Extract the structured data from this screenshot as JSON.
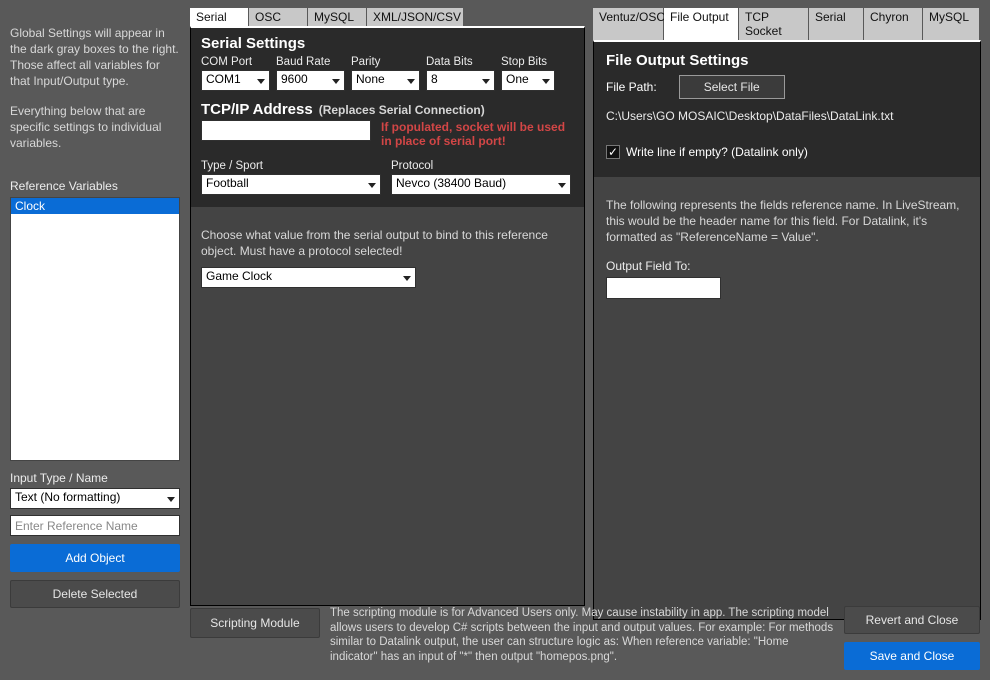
{
  "intro": {
    "p1": "Global Settings will appear in the dark gray boxes to the right. Those affect all variables for that Input/Output type.",
    "p2": "Everything below that are specific settings to individual variables."
  },
  "reference_variables": {
    "label": "Reference Variables",
    "items": [
      "Clock"
    ]
  },
  "input_type": {
    "label": "Input Type / Name",
    "value": "Text (No formatting)"
  },
  "ref_name_placeholder": "Enter Reference Name",
  "buttons": {
    "add_object": "Add Object",
    "delete_selected": "Delete Selected",
    "scripting_module": "Scripting Module",
    "revert_close": "Revert and Close",
    "save_close": "Save and Close"
  },
  "input_tabs": [
    "Serial",
    "OSC",
    "MySQL",
    "XML/JSON/CSV"
  ],
  "input_tab_widths": [
    58,
    58,
    58,
    96
  ],
  "input_active_tab": 0,
  "serial": {
    "title": "Serial Settings",
    "labels": {
      "com": "COM Port",
      "baud": "Baud Rate",
      "parity": "Parity",
      "data_bits": "Data Bits",
      "stop_bits": "Stop Bits"
    },
    "values": {
      "com": "COM1",
      "baud": "9600",
      "parity": "None",
      "data_bits": "8",
      "stop_bits": "One"
    },
    "tcp_title": "TCP/IP Address",
    "tcp_sub": "(Replaces Serial Connection)",
    "tcp_value": "",
    "tcp_warn1": "If populated, socket will be used",
    "tcp_warn2": "in place of serial port!",
    "type_label": "Type / Sport",
    "type_value": "Football",
    "protocol_label": "Protocol",
    "protocol_value": "Nevco (38400 Baud)"
  },
  "bind": {
    "help": "Choose what value from the serial output to bind to this reference object. Must have a protocol selected!",
    "value": "Game Clock"
  },
  "output_tabs": [
    "Ventuz/OSC",
    "File Output",
    "TCP Socket",
    "Serial",
    "Chyron",
    "MySQL"
  ],
  "output_tab_widths": [
    70,
    74,
    69,
    50,
    58,
    56
  ],
  "output_active_tab": 1,
  "file_output": {
    "title": "File Output Settings",
    "file_path_label": "File Path:",
    "select_file": "Select File",
    "path_value": "C:\\Users\\GO MOSAIC\\Desktop\\DataFiles\\DataLink.txt",
    "write_empty_label": "Write line if empty? (Datalink only)",
    "write_empty_checked": true
  },
  "output_field": {
    "help": "The following represents the fields reference name. In LiveStream, this would be the header name for this field. For Datalink, it's formatted as \"ReferenceName = Value\".",
    "label": "Output Field To:",
    "value": ""
  },
  "scripting_help": "The scripting module is for Advanced Users only. May cause instability in app. The scripting model allows users to develop C# scripts between the input and output values. For example: For methods similar to Datalink output, the user can structure logic as: When reference variable: \"Home indicator\" has an input of \"*\" then output \"homepos.png\"."
}
